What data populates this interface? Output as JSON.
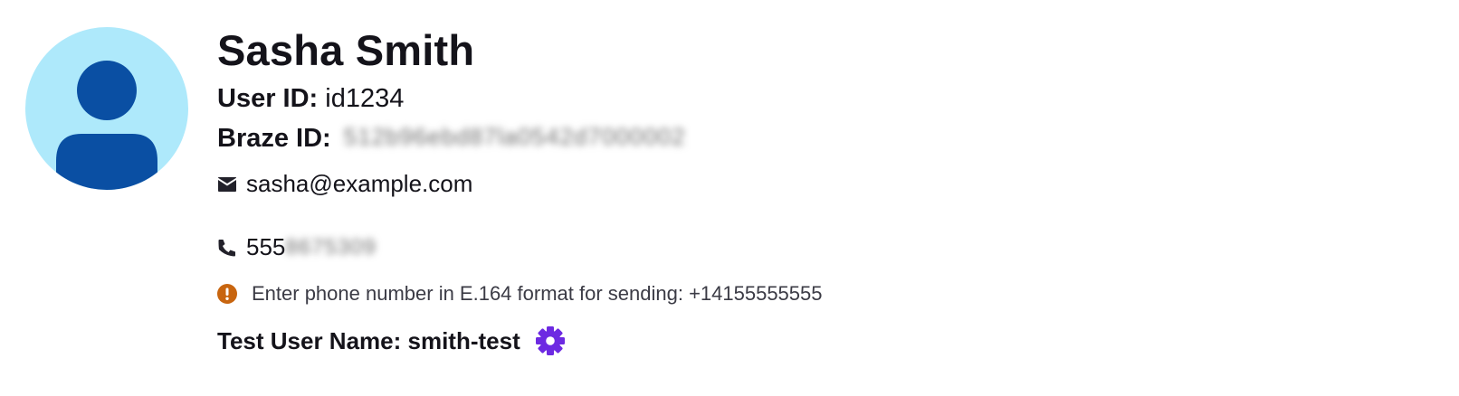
{
  "profile": {
    "name": "Sasha Smith",
    "user_id_label": "User ID:",
    "user_id_value": "id1234",
    "braze_id_label": "Braze ID:",
    "braze_id_value": "512b96ebd87la0542d7000002",
    "email": "sasha@example.com",
    "phone_visible": "555",
    "phone_hidden": "8675309",
    "phone_warning": "Enter phone number in E.164 format for sending: +14155555555",
    "test_user_label": "Test User Name:",
    "test_user_value": "smith-test"
  },
  "icons": {
    "avatar": "user-avatar-icon",
    "email": "envelope-icon",
    "phone": "phone-icon",
    "warning": "exclamation-circle-icon",
    "settings": "gear-icon"
  },
  "colors": {
    "avatar_bg": "#aee9fb",
    "avatar_figure": "#0a4fa3",
    "warning": "#c8650f",
    "gear": "#6d2ae2",
    "text": "#14131a"
  }
}
